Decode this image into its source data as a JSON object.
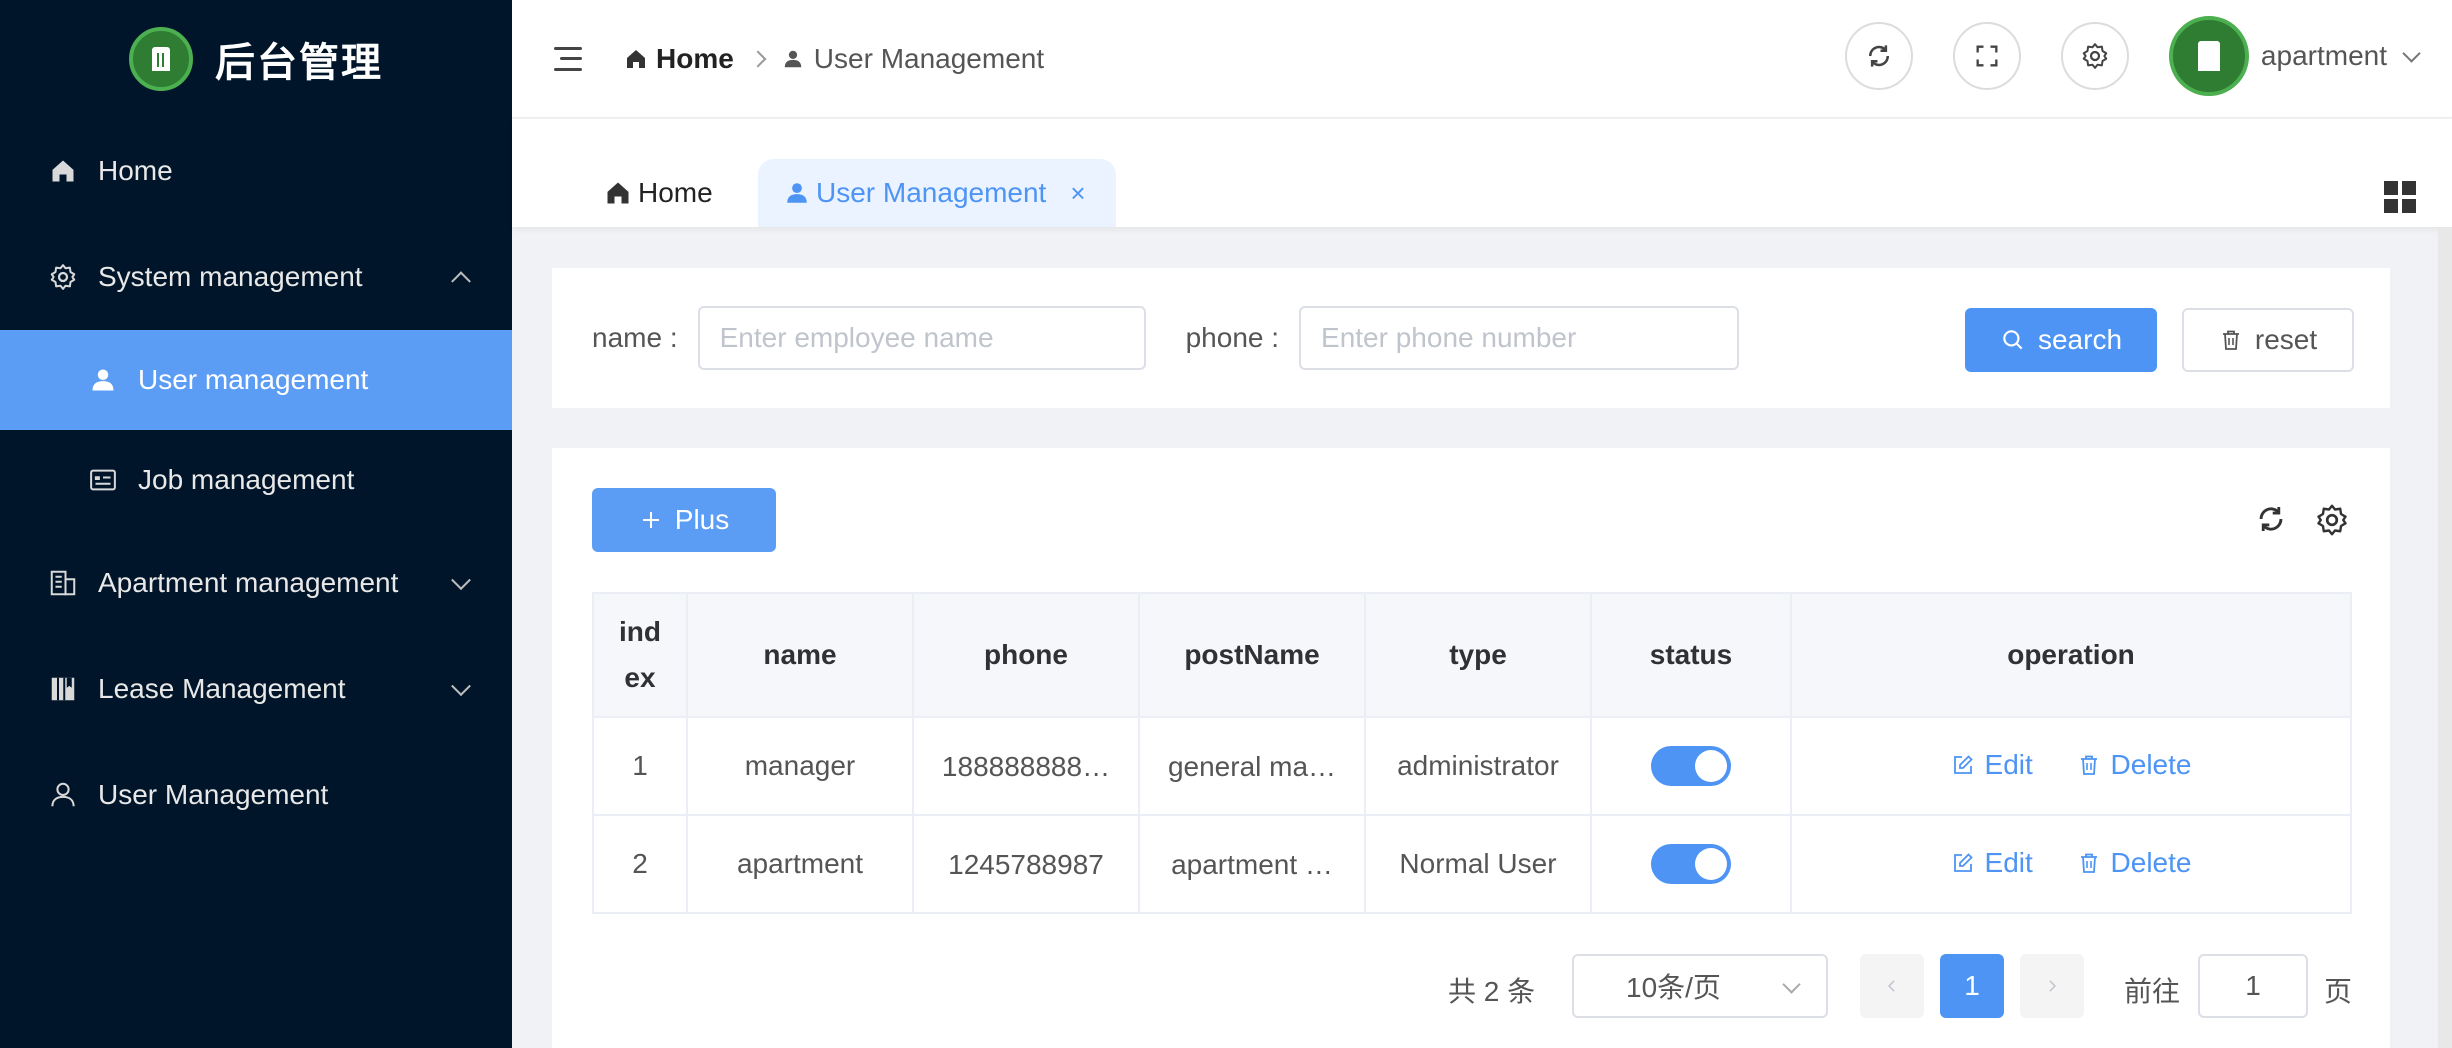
{
  "app": {
    "brand_title": "后台管理"
  },
  "sidebar": {
    "items": [
      {
        "label": "Home",
        "icon": "home-icon"
      },
      {
        "label": "System management",
        "icon": "gear-icon",
        "expanded": true,
        "children": [
          {
            "label": "User management",
            "icon": "user-icon",
            "active": true
          },
          {
            "label": "Job management",
            "icon": "id-card-icon"
          }
        ]
      },
      {
        "label": "Apartment management",
        "icon": "building-icon"
      },
      {
        "label": "Lease Management",
        "icon": "book-icon"
      },
      {
        "label": "User Management",
        "icon": "user-outline-icon"
      }
    ]
  },
  "header": {
    "breadcrumb": {
      "home": "Home",
      "current": "User Management"
    },
    "user": {
      "name": "apartment"
    }
  },
  "tabs": [
    {
      "label": "Home"
    },
    {
      "label": "User Management",
      "active": true,
      "close": "×"
    }
  ],
  "search": {
    "name_label": "name :",
    "name_placeholder": "Enter employee name",
    "phone_label": "phone :",
    "phone_placeholder": "Enter phone number",
    "search_label": "search",
    "reset_label": "reset"
  },
  "table": {
    "plus_label": "Plus",
    "columns": [
      "ind ex",
      "name",
      "phone",
      "postName",
      "type",
      "status",
      "operation"
    ],
    "rows": [
      {
        "index": "1",
        "name": "manager",
        "phone": "188888888…",
        "postName": "general ma…",
        "type": "administrator",
        "status": true,
        "edit": "Edit",
        "delete": "Delete"
      },
      {
        "index": "2",
        "name": "apartment",
        "phone": "1245788987",
        "postName": "apartment …",
        "type": "Normal User",
        "status": true,
        "edit": "Edit",
        "delete": "Delete"
      }
    ]
  },
  "pagination": {
    "total_text": "共 2 条",
    "page_size": "10条/页",
    "current_page": "1",
    "goto_label": "前往",
    "goto_value": "1",
    "page_suffix": "页"
  },
  "colors": {
    "sidebar_bg": "#001529",
    "accent": "#4d94f5",
    "active_menu": "#5b9cf5"
  }
}
